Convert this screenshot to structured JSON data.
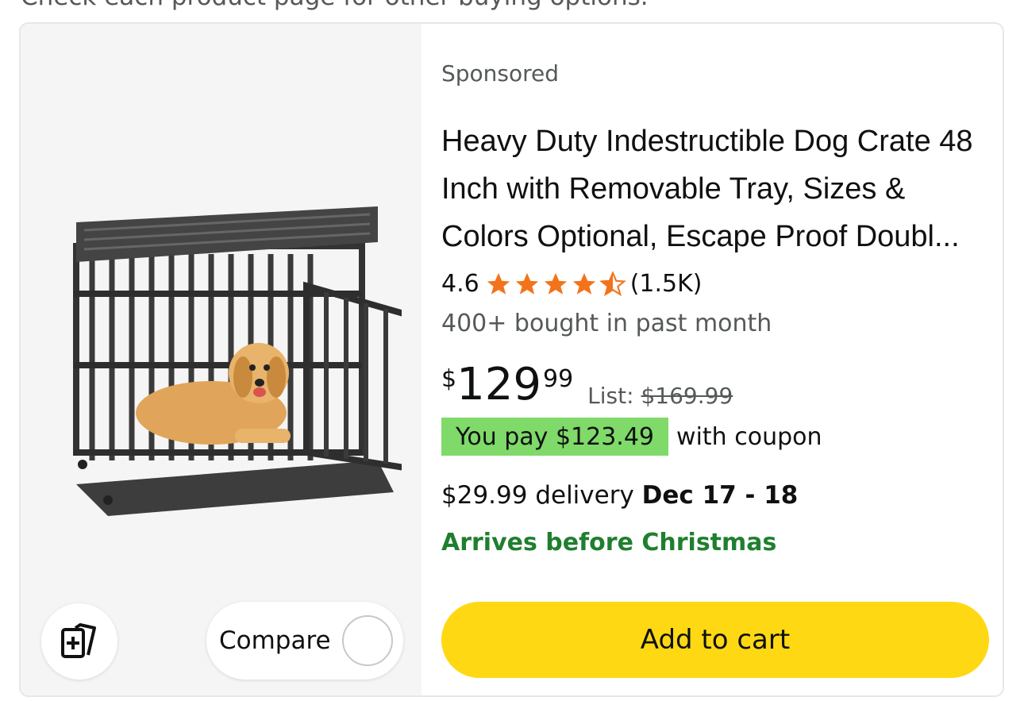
{
  "page": {
    "top_note": "Check each product page for other buying options."
  },
  "product": {
    "sponsored_label": "Sponsored",
    "title": "Heavy Duty Indestructible Dog Crate 48 Inch with Removable Tray, Sizes & Colors Optional, Escape Proof Doubl...",
    "rating": "4.6",
    "rating_value": 4.6,
    "rating_max": 5,
    "review_count": "(1.5K)",
    "bought_text": "400+ bought in past month",
    "price_symbol": "$",
    "price_whole": "129",
    "price_fraction": "99",
    "list_label": "List:",
    "list_price": "$169.99",
    "coupon_badge": "You pay $123.49",
    "coupon_text": "with coupon",
    "delivery_text": "$29.99 delivery",
    "delivery_date": "Dec 17 - 18",
    "arrives_text": "Arrives before Christmas",
    "image_icon": "dog-crate-product-image"
  },
  "actions": {
    "collect_icon": "add-to-collection-icon",
    "compare_label": "Compare",
    "add_to_cart_label": "Add to cart"
  },
  "colors": {
    "star": "#f3731b",
    "coupon_bg": "#7fda69",
    "arrives_green": "#1f7f2f",
    "cart_button": "#ffd814"
  }
}
